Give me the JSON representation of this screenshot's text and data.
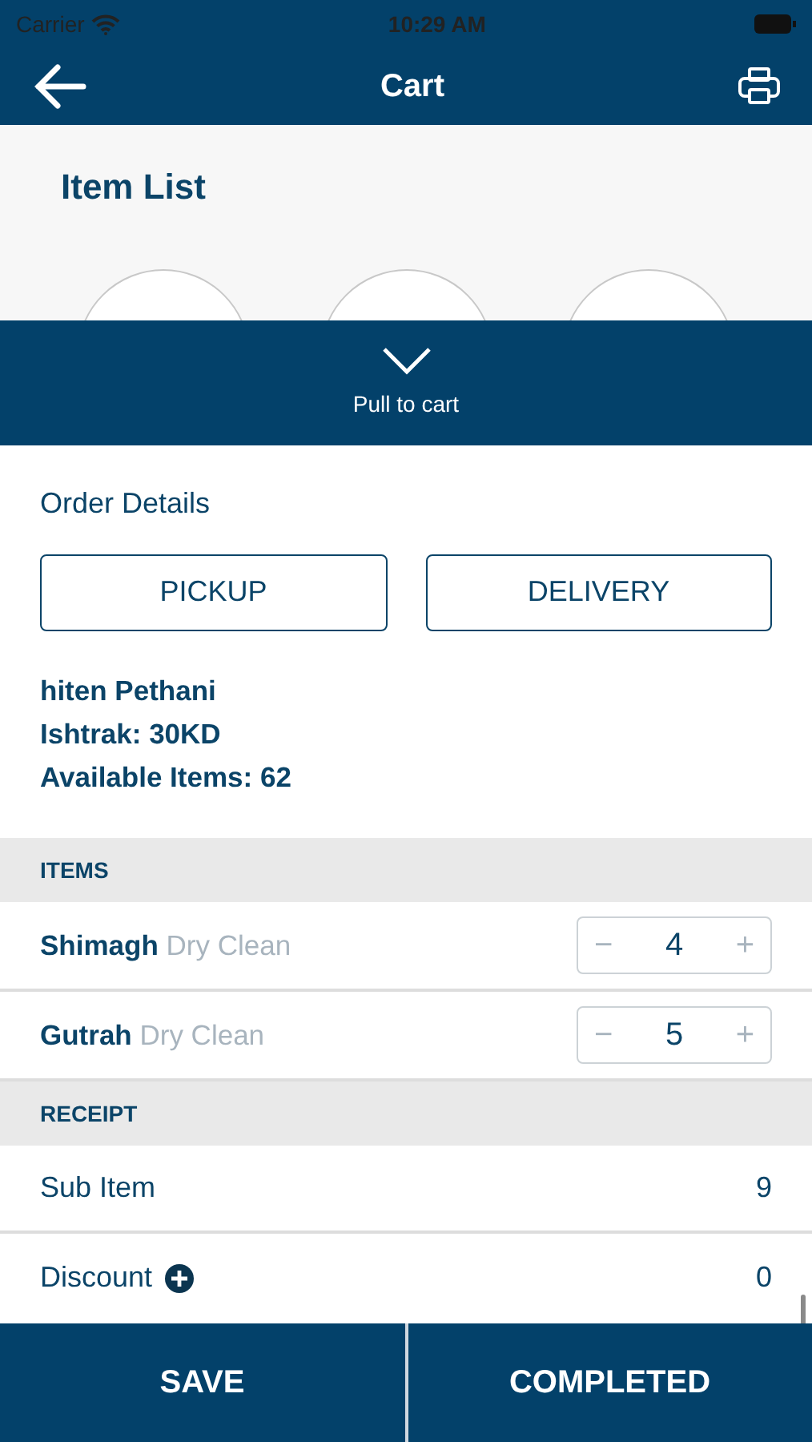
{
  "status_bar": {
    "carrier": "Carrier",
    "time": "10:29 AM"
  },
  "nav": {
    "title": "Cart"
  },
  "item_list": {
    "title": "Item List"
  },
  "pull_bar": {
    "label": "Pull to cart"
  },
  "order_details": {
    "title": "Order Details",
    "buttons": [
      "PICKUP",
      "DELIVERY"
    ],
    "info": [
      "hiten Pethani",
      "Ishtrak: 30KD",
      "Available Items: 62"
    ]
  },
  "items": {
    "header": "ITEMS",
    "rows": [
      {
        "name": "Shimagh",
        "service": "Dry Clean",
        "minus": "−",
        "quantity": "4",
        "plus": "+"
      },
      {
        "name": "Gutrah",
        "service": "Dry Clean",
        "minus": "−",
        "quantity": "5",
        "plus": "+"
      }
    ]
  },
  "receipt": {
    "header": "RECEIPT",
    "rows": [
      {
        "label": "Sub Item",
        "value": "9",
        "kind": "plain"
      },
      {
        "label": "Discount",
        "value": "0",
        "kind": "add"
      }
    ]
  },
  "footer": [
    "SAVE",
    "COMPLETED"
  ]
}
